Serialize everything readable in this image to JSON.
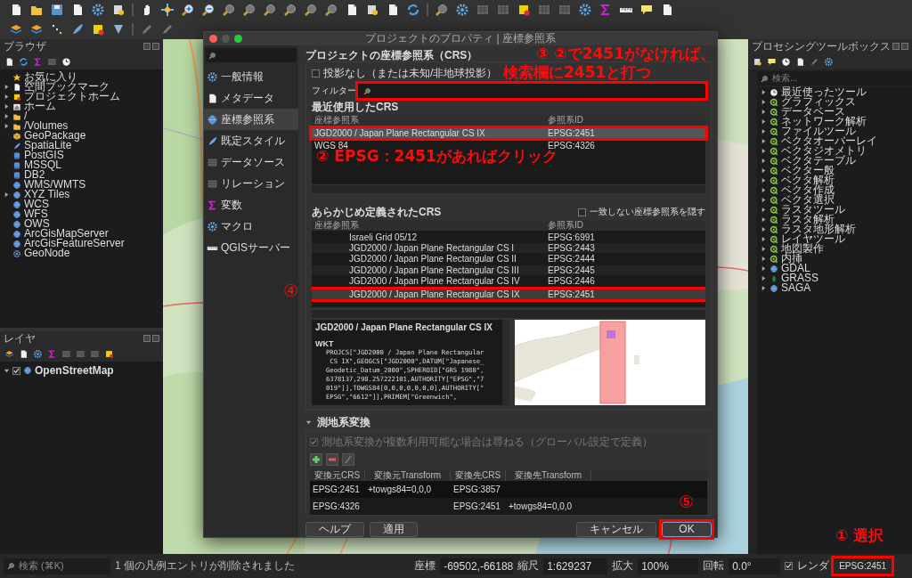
{
  "browser_panel": {
    "title": "ブラウザ",
    "items": [
      {
        "label": "お気に入り",
        "collapsible": false
      },
      {
        "label": "空間ブックマーク",
        "collapsible": true
      },
      {
        "label": "プロジェクトホーム",
        "collapsible": true
      },
      {
        "label": "ホーム",
        "collapsible": true
      },
      {
        "label": "/",
        "collapsible": true
      },
      {
        "label": "/Volumes",
        "collapsible": true
      },
      {
        "label": "GeoPackage",
        "collapsible": false
      },
      {
        "label": "SpatiaLite",
        "collapsible": false
      },
      {
        "label": "PostGIS",
        "collapsible": false
      },
      {
        "label": "MSSQL",
        "collapsible": false
      },
      {
        "label": "DB2",
        "collapsible": false
      },
      {
        "label": "WMS/WMTS",
        "collapsible": false
      },
      {
        "label": "XYZ Tiles",
        "collapsible": true
      },
      {
        "label": "WCS",
        "collapsible": false
      },
      {
        "label": "WFS",
        "collapsible": false
      },
      {
        "label": "OWS",
        "collapsible": false
      },
      {
        "label": "ArcGisMapServer",
        "collapsible": false
      },
      {
        "label": "ArcGisFeatureServer",
        "collapsible": false
      },
      {
        "label": "GeoNode",
        "collapsible": false
      }
    ]
  },
  "layers_panel": {
    "title": "レイヤ",
    "layers": [
      {
        "label": "OpenStreetMap",
        "visible": true,
        "expanded": true
      }
    ]
  },
  "processing_panel": {
    "title": "プロセシングツールボックス",
    "search_placeholder": "検索...",
    "items": [
      "最近使ったツール",
      "グラフィックス",
      "データベース",
      "ネットワーク解析",
      "ファイルツール",
      "ベクタオーバーレイ",
      "ベクタジオメトリ",
      "ベクタテーブル",
      "ベクター般",
      "ベクタ解析",
      "ベクタ作成",
      "ベクタ選択",
      "ラスタツール",
      "ラスタ解析",
      "ラスタ地形解析",
      "レイヤツール",
      "地図製作",
      "内挿",
      "GDAL",
      "GRASS",
      "SAGA"
    ]
  },
  "dialog": {
    "title": "プロジェクトのプロパティ | 座標参照系",
    "sidebar": [
      {
        "label": "一般情報",
        "selected": false
      },
      {
        "label": "メタデータ",
        "selected": false
      },
      {
        "label": "座標参照系",
        "selected": true
      },
      {
        "label": "既定スタイル",
        "selected": false
      },
      {
        "label": "データソース",
        "selected": false
      },
      {
        "label": "リレーション",
        "selected": false
      },
      {
        "label": "変数",
        "selected": false
      },
      {
        "label": "マクロ",
        "selected": false
      },
      {
        "label": "QGISサーバー",
        "selected": false
      }
    ],
    "section_title": "プロジェクトの座標参照系（CRS）",
    "no_projection": {
      "label": "投影なし（または未知/非地球投影）",
      "checked": false
    },
    "filter": {
      "label": "フィルター"
    },
    "recent": {
      "title": "最近使用したCRS",
      "columns": [
        "座標参照系",
        "参照系ID"
      ],
      "rows": [
        {
          "name": "JGD2000 / Japan Plane Rectangular CS IX",
          "id": "EPSG:2451",
          "selected": true
        },
        {
          "name": "WGS 84",
          "id": "EPSG:4326",
          "selected": false
        }
      ]
    },
    "predefined": {
      "title": "あらかじめ定義されたCRS",
      "hide_deprecated": {
        "label": "一致しない座標参照系を隠す",
        "checked": false
      },
      "columns": [
        "座標参照系",
        "参照系ID"
      ],
      "rows": [
        {
          "name": "Israeli Grid 05/12",
          "id": "EPSG:6991",
          "selected": false
        },
        {
          "name": "JGD2000 / Japan Plane Rectangular CS I",
          "id": "EPSG:2443",
          "selected": false
        },
        {
          "name": "JGD2000 / Japan Plane Rectangular CS II",
          "id": "EPSG:2444",
          "selected": false
        },
        {
          "name": "JGD2000 / Japan Plane Rectangular CS III",
          "id": "EPSG:2445",
          "selected": false
        },
        {
          "name": "JGD2000 / Japan Plane Rectangular CS IV",
          "id": "EPSG:2446",
          "selected": false
        },
        {
          "name": "JGD2000 / Japan Plane Rectangular CS IX",
          "id": "EPSG:2451",
          "selected": true
        }
      ]
    },
    "details": {
      "name": "JGD2000 / Japan Plane Rectangular CS IX",
      "heading": "WKT",
      "lines": [
        "PROJCS[\"JGD2000 / Japan Plane Rectangular",
        " CS IX\",GEOGCS[\"JGD2000\",DATUM[\"Japanese_",
        "Geodetic_Datum_2000\",SPHEROID[\"GRS 1980\",",
        "6378137,298.257222101,AUTHORITY[\"EPSG\",\"7",
        "019\"]],TOWGS84[0,0,0,0,0,0,0],AUTHORITY[\"",
        "EPSG\",\"6612\"]],PRIMEM[\"Greenwich\","
      ]
    },
    "transform": {
      "title": "測地系変換",
      "expanded": true,
      "ask": {
        "label": "測地系変換が複数利用可能な場合は尋ねる（グローバル設定で定義）",
        "checked": true,
        "disabled": true
      },
      "columns": [
        "変換元CRS",
        "変換元Transform",
        "変換先CRS",
        "変換先Transform"
      ],
      "rows": [
        {
          "source_crs": "EPSG:2451",
          "source_transform": "+towgs84=0,0,0",
          "dest_crs": "EPSG:3857"
        },
        {
          "source_crs": "EPSG:4326",
          "dest_crs": "EPSG:2451",
          "dest_transform": "+towgs84=0,0,0"
        }
      ]
    },
    "buttons": [
      {
        "label": "ヘルプ",
        "default": false
      },
      {
        "label": "適用",
        "default": false
      },
      {
        "label": "キャンセル",
        "default": false
      },
      {
        "label": "OK",
        "default": true
      }
    ]
  },
  "status_bar": {
    "search_placeholder": "検索 (⌘K)",
    "message": "1 個の凡例エントリが削除されました",
    "coordinate_label": "座標",
    "coordinate": "-69502,-66188",
    "scale_label": "縮尺",
    "scale": "1:629237",
    "magnifier_label": "拡大",
    "magnifier": "100%",
    "rotation_label": "回転",
    "rotation": "0.0°",
    "render": {
      "label": "レンダ",
      "checked": true
    },
    "crs": "EPSG:2451"
  },
  "annotations": [
    {
      "kind": "callout",
      "text": "③ ②で2451がなければ、"
    },
    {
      "kind": "callout",
      "text": "検索欄に2451と打つ"
    },
    {
      "kind": "callout",
      "text": "② EPSG：2451があればクリック"
    },
    {
      "kind": "marker",
      "text": "④"
    },
    {
      "kind": "marker",
      "text": "⑤"
    },
    {
      "kind": "callout",
      "text": "① 選択"
    }
  ]
}
